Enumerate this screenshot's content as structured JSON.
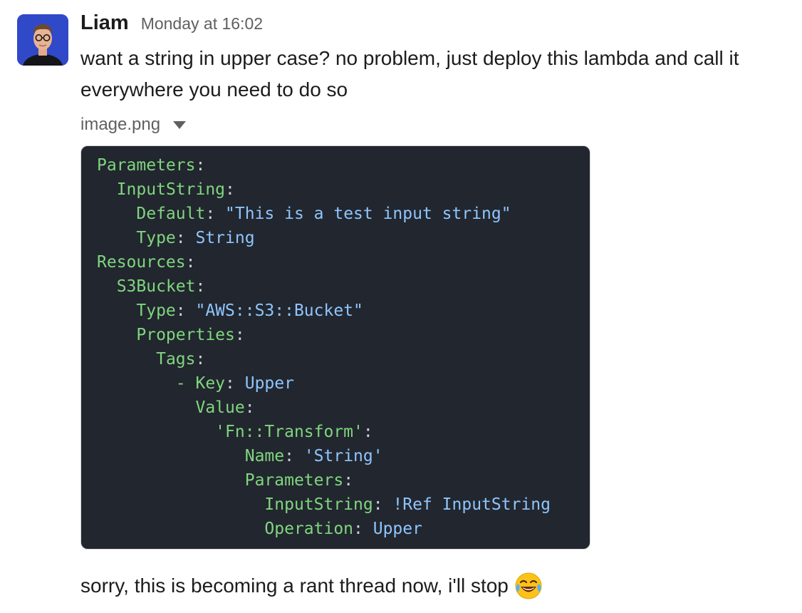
{
  "message": {
    "author": "Liam",
    "timestamp": "Monday at 16:02",
    "text_line1": "want a string in upper case? no problem, just deploy this lambda and call it",
    "text_line2": "everywhere you need to do so",
    "attachment": {
      "file_name": "image.png",
      "code_lines": [
        {
          "indent": "",
          "key": "Parameters",
          "sep": ":",
          "value": ""
        },
        {
          "indent": "  ",
          "key": "InputString",
          "sep": ":",
          "value": ""
        },
        {
          "indent": "    ",
          "key": "Default",
          "sep": ": ",
          "value": "\"This is a test input string\""
        },
        {
          "indent": "    ",
          "key": "Type",
          "sep": ": ",
          "value": "String"
        },
        {
          "indent": "",
          "key": "Resources",
          "sep": ":",
          "value": ""
        },
        {
          "indent": "  ",
          "key": "S3Bucket",
          "sep": ":",
          "value": ""
        },
        {
          "indent": "    ",
          "key": "Type",
          "sep": ": ",
          "value": "\"AWS::S3::Bucket\""
        },
        {
          "indent": "    ",
          "key": "Properties",
          "sep": ":",
          "value": ""
        },
        {
          "indent": "      ",
          "key": "Tags",
          "sep": ":",
          "value": ""
        },
        {
          "indent": "        ",
          "key": "- Key",
          "sep": ": ",
          "value": "Upper"
        },
        {
          "indent": "          ",
          "key": "Value",
          "sep": ":",
          "value": ""
        },
        {
          "indent": "            ",
          "key": "'Fn::Transform'",
          "sep": ":",
          "value": ""
        },
        {
          "indent": "               ",
          "key": "Name",
          "sep": ": ",
          "value": "'String'"
        },
        {
          "indent": "               ",
          "key": "Parameters",
          "sep": ":",
          "value": ""
        },
        {
          "indent": "                 ",
          "key": "InputString",
          "sep": ": ",
          "value": "!Ref InputString"
        },
        {
          "indent": "                 ",
          "key": "Operation",
          "sep": ": ",
          "value": "Upper"
        }
      ]
    }
  },
  "reply": {
    "text": "sorry, this is becoming a rant thread now, i'll stop",
    "emoji": "joy-emoji"
  },
  "colors": {
    "avatar_bg": "#3049c8",
    "code_bg": "#22262e",
    "code_key": "#7fd67f",
    "code_value": "#8ec5ff"
  }
}
